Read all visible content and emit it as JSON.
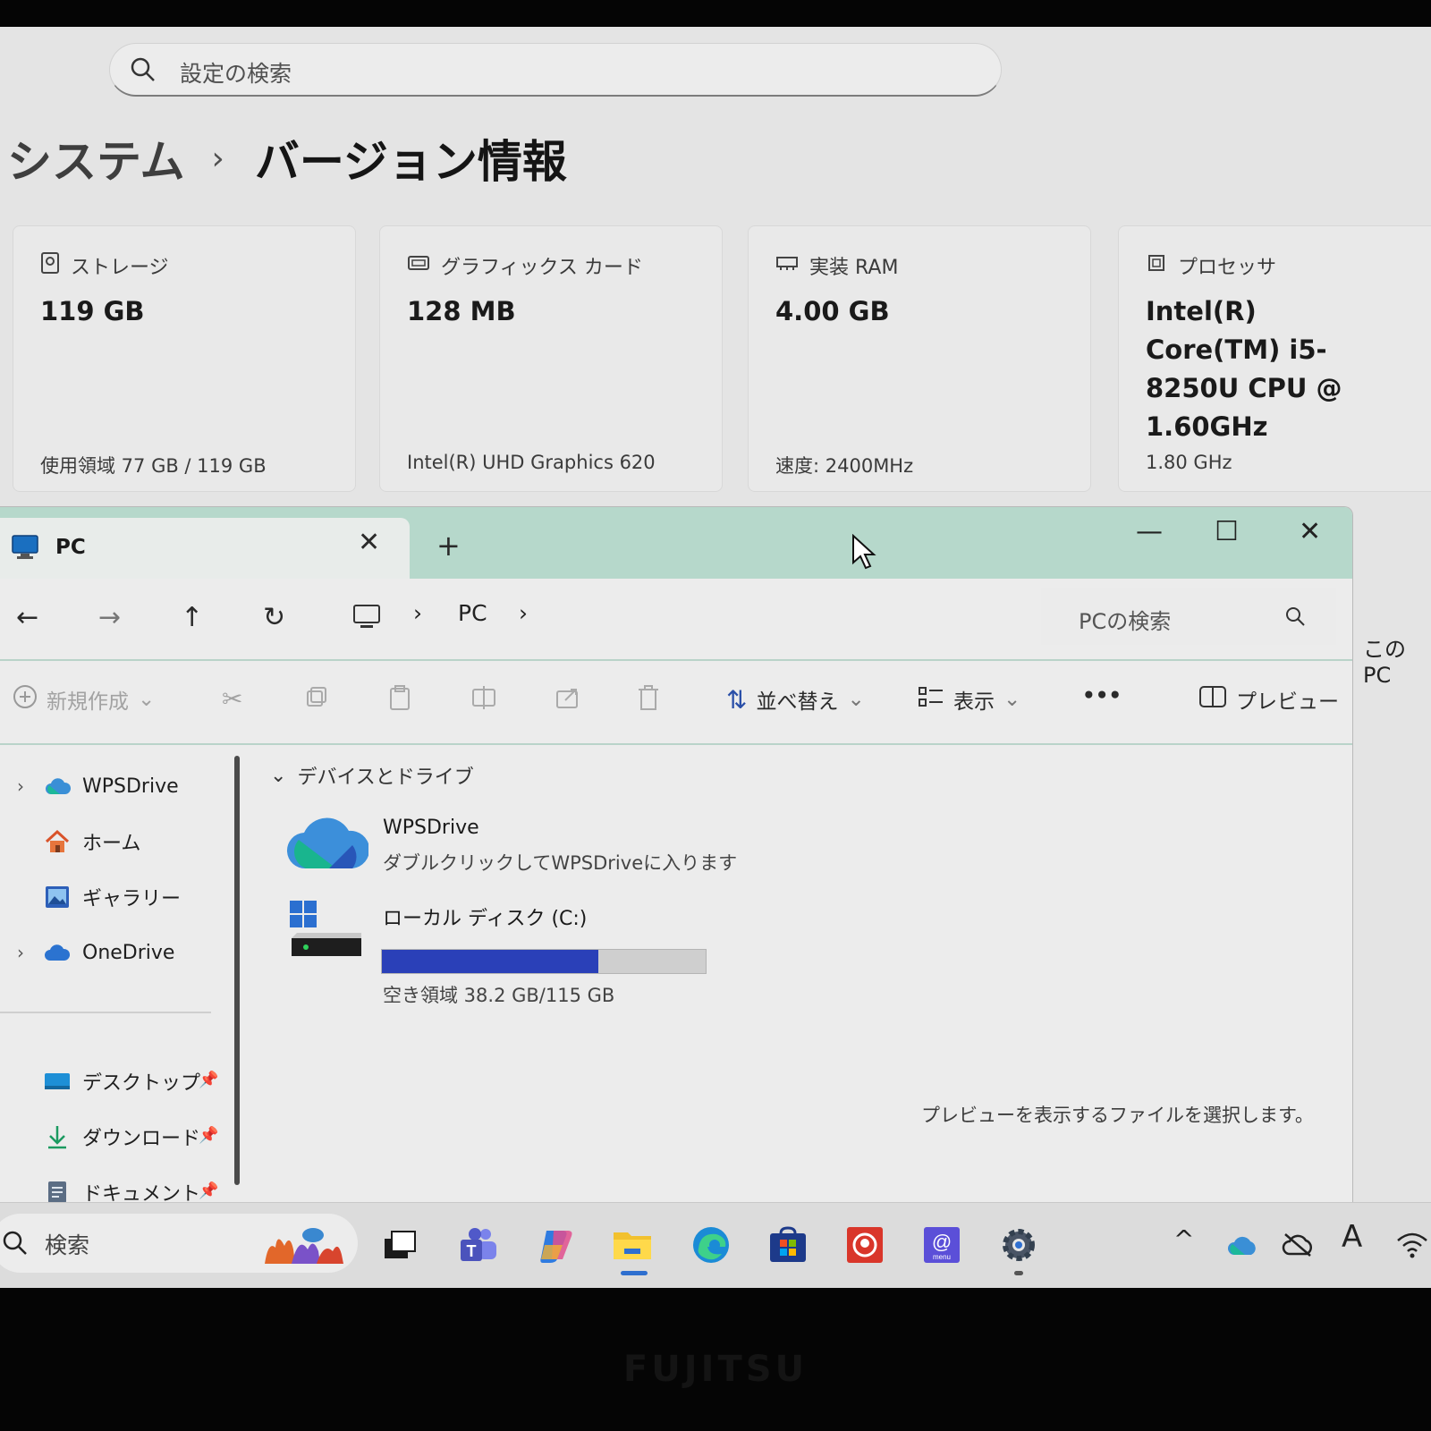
{
  "settings": {
    "search_placeholder": "設定の検索",
    "breadcrumb_parent": "システム",
    "breadcrumb_sep": "›",
    "breadcrumb_current": "バージョン情報",
    "cards": [
      {
        "icon": "storage-icon",
        "label": "ストレージ",
        "value": "119 GB",
        "sub": "使用領域 77 GB / 119 GB"
      },
      {
        "icon": "graphics-card-icon",
        "label": "グラフィックス カード",
        "value": "128 MB",
        "sub": "Intel(R) UHD Graphics 620"
      },
      {
        "icon": "ram-icon",
        "label": "実装 RAM",
        "value": "4.00 GB",
        "sub": "速度: 2400MHz"
      },
      {
        "icon": "processor-icon",
        "label": "プロセッサ",
        "value": "Intel(R) Core(TM) i5-8250U CPU @ 1.60GHz",
        "sub": "1.80 GHz"
      }
    ],
    "side_peek": "この PC"
  },
  "explorer": {
    "tab_title": "PC",
    "tab_close": "✕",
    "new_tab": "+",
    "window_min": "—",
    "window_max": "☐",
    "window_close": "✕",
    "path_pc": "PC",
    "path_sep": "›",
    "search_placeholder": "PCの検索",
    "toolbar": {
      "new_label": "新規作成",
      "sort_label": "並べ替え",
      "view_label": "表示",
      "more_label": "•••",
      "preview_label": "プレビュー"
    },
    "nav": [
      {
        "label": "WPSDrive",
        "icon": "cloud-icon"
      },
      {
        "label": "ホーム",
        "icon": "home-icon"
      },
      {
        "label": "ギャラリー",
        "icon": "gallery-icon"
      },
      {
        "label": "OneDrive",
        "icon": "onedrive-icon"
      },
      {
        "label": "デスクトップ",
        "icon": "desktop-icon"
      },
      {
        "label": "ダウンロード",
        "icon": "download-icon"
      },
      {
        "label": "ドキュメント",
        "icon": "document-icon"
      }
    ],
    "group_header": "デバイスとドライブ",
    "drives": [
      {
        "name": "WPSDrive",
        "sub": "ダブルクリックしてWPSDriveに入ります"
      },
      {
        "name": "ローカル ディスク (C:)",
        "sub": "空き領域 38.2 GB/115 GB",
        "used_fraction": 0.668
      }
    ],
    "preview_message": "プレビューを表示するファイルを選択します。"
  },
  "taskbar": {
    "search_placeholder": "検索",
    "apps": [
      "task-view-icon",
      "teams-icon",
      "copilot-icon",
      "file-explorer-icon",
      "edge-icon",
      "store-icon",
      "app-red-icon",
      "mail-menu-icon",
      "settings-gear-icon"
    ],
    "tray_ime": "A",
    "tray_chevron": "^"
  },
  "brand": "FUJITSU"
}
